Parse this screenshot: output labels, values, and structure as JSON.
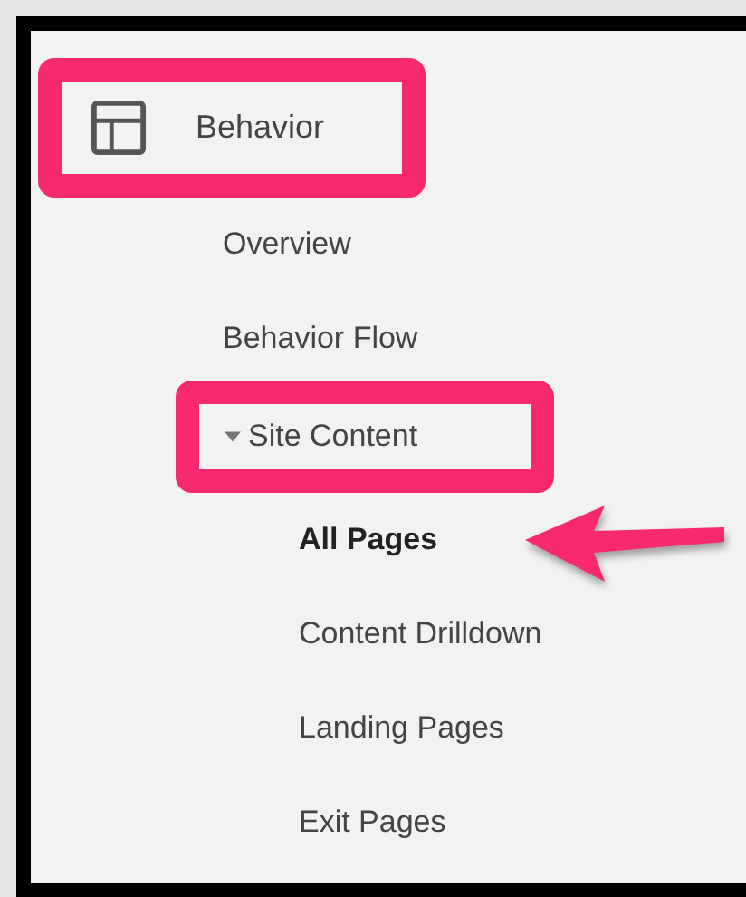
{
  "nav": {
    "section": {
      "label": "Behavior",
      "highlighted": true
    },
    "items": [
      {
        "kind": "link",
        "label": "Overview",
        "selected": false,
        "highlighted": false
      },
      {
        "kind": "link",
        "label": "Behavior Flow",
        "selected": false,
        "highlighted": false
      },
      {
        "kind": "group",
        "label": "Site Content",
        "selected": false,
        "highlighted": true,
        "expanded": true,
        "children": [
          {
            "label": "All Pages",
            "selected": true,
            "pointed_at": true
          },
          {
            "label": "Content Drilldown",
            "selected": false,
            "pointed_at": false
          },
          {
            "label": "Landing Pages",
            "selected": false,
            "pointed_at": false
          },
          {
            "label": "Exit Pages",
            "selected": false,
            "pointed_at": false
          }
        ]
      }
    ]
  }
}
